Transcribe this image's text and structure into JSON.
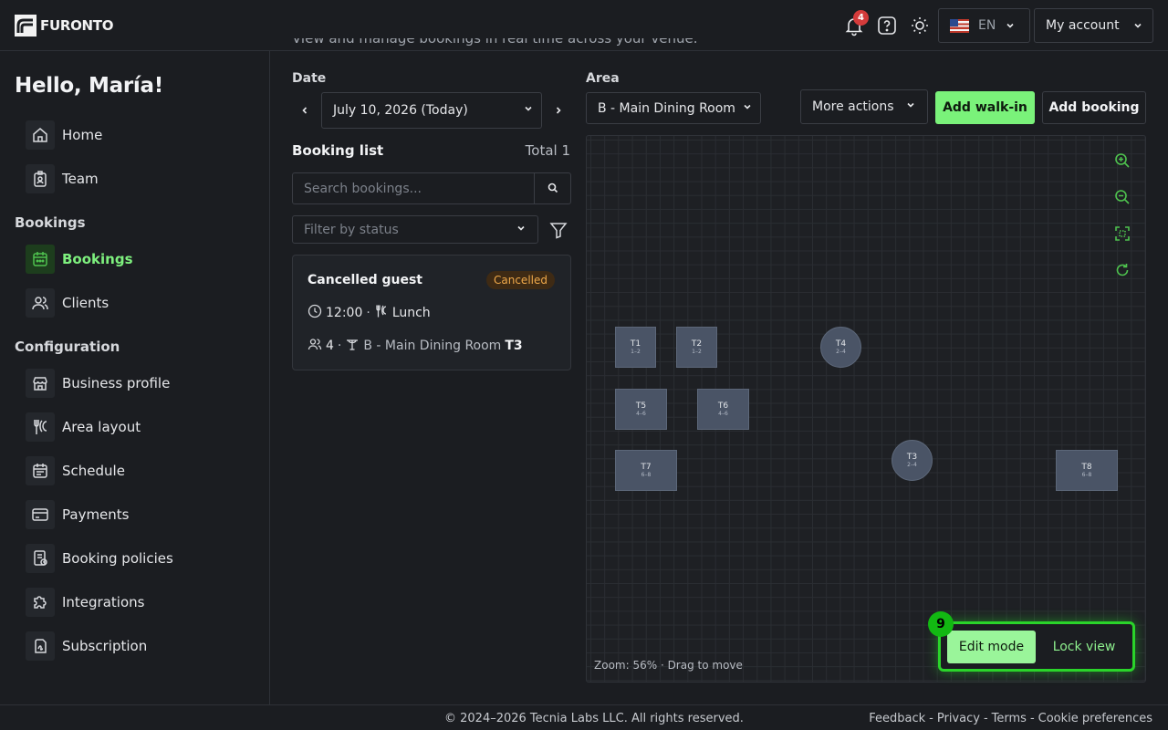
{
  "app": {
    "brand": "FURONTO"
  },
  "topbar": {
    "notifications_count": "4",
    "language": "EN",
    "account_label": "My account",
    "icons": [
      "bell-icon",
      "help-icon",
      "sun-icon",
      "flag-us-icon",
      "chevron-down-icon"
    ]
  },
  "sidebar": {
    "greeting": "Hello, María!",
    "items_top": [
      {
        "label": "Home",
        "icon": "home-icon"
      },
      {
        "label": "Team",
        "icon": "badge-icon"
      }
    ],
    "section_bookings": "Bookings",
    "items_bookings": [
      {
        "label": "Bookings",
        "icon": "calendar-icon",
        "active": true
      },
      {
        "label": "Clients",
        "icon": "users-icon"
      }
    ],
    "section_config": "Configuration",
    "items_config": [
      {
        "label": "Business profile",
        "icon": "store-icon"
      },
      {
        "label": "Area layout",
        "icon": "utensils-icon"
      },
      {
        "label": "Schedule",
        "icon": "schedule-icon"
      },
      {
        "label": "Payments",
        "icon": "card-icon"
      },
      {
        "label": "Booking policies",
        "icon": "policy-icon"
      },
      {
        "label": "Integrations",
        "icon": "puzzle-icon"
      },
      {
        "label": "Subscription",
        "icon": "subscription-icon"
      }
    ]
  },
  "main": {
    "subtitle": "View and manage bookings in real time across your venue.",
    "date_label": "Date",
    "date_value": "July 10, 2026 (Today)",
    "area_label": "Area",
    "area_value": "B - Main Dining Room",
    "more_actions": "More actions",
    "add_walkin": "Add walk-in",
    "add_booking": "Add booking",
    "booking_list_title": "Booking list",
    "booking_total": "Total 1",
    "search_placeholder": "Search bookings...",
    "filter_placeholder": "Filter by status",
    "booking": {
      "name": "Cancelled guest",
      "status": "Cancelled",
      "time": "12:00",
      "service": "Lunch",
      "guests": "4",
      "area": "B - Main Dining Room",
      "table": "T3"
    }
  },
  "floor": {
    "tables": [
      {
        "name": "T1",
        "capacity": "1–2",
        "shape": "square"
      },
      {
        "name": "T2",
        "capacity": "1–2",
        "shape": "square"
      },
      {
        "name": "T4",
        "capacity": "2–4",
        "shape": "round"
      },
      {
        "name": "T5",
        "capacity": "4–6",
        "shape": "square"
      },
      {
        "name": "T6",
        "capacity": "4–6",
        "shape": "square"
      },
      {
        "name": "T7",
        "capacity": "6–8",
        "shape": "square"
      },
      {
        "name": "T3",
        "capacity": "2–4",
        "shape": "round"
      },
      {
        "name": "T8",
        "capacity": "6–8",
        "shape": "square"
      }
    ],
    "zoom_info": "Zoom: 56% · Drag to move",
    "edit_mode": "Edit mode",
    "lock_view": "Lock view",
    "step_number": "9",
    "controls": [
      "zoom-in-icon",
      "zoom-out-icon",
      "fit-screen-icon",
      "refresh-icon"
    ]
  },
  "footer": {
    "copyright": "© 2024–2026 Tecnia Labs LLC. All rights reserved.",
    "feedback": "Feedback",
    "privacy": "Privacy",
    "terms": "Terms",
    "cookies": "Cookie preferences",
    "separator": "-"
  },
  "colors": {
    "accent": "#7af27a",
    "accent_dark": "#2ad42a",
    "badge_red": "#d43b3b",
    "cancelled": "#f0a94a",
    "table": "#4a5466"
  }
}
